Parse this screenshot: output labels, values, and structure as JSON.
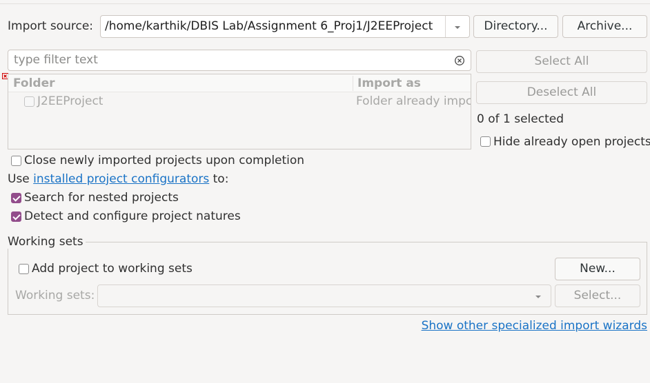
{
  "import_source": {
    "label": "Import source:",
    "value": "/home/karthik/DBIS Lab/Assignment 6_Proj1/J2EEProject",
    "directory_button": "Directory...",
    "archive_button": "Archive..."
  },
  "filter": {
    "placeholder": "type filter text"
  },
  "table": {
    "columns": [
      "Folder",
      "Import as"
    ],
    "rows": [
      {
        "folder": "J2EEProject",
        "import_as": "Folder already impc"
      }
    ]
  },
  "side": {
    "select_all": "Select All",
    "deselect_all": "Deselect All",
    "selected_count": "0 of 1 selected",
    "hide_open_label": "Hide already open projects"
  },
  "options": {
    "close_projects_label": "Close newly imported projects upon completion",
    "use_prefix": "Use",
    "configurators_link": "installed project configurators",
    "use_suffix": "to:",
    "search_nested_label": "Search for nested projects",
    "detect_natures_label": "Detect and configure project natures"
  },
  "working_sets": {
    "group_title": "Working sets",
    "add_label": "Add project to working sets",
    "new_button": "New...",
    "sets_label": "Working sets:",
    "select_button": "Select..."
  },
  "footer": {
    "wizards_link": "Show other specialized import wizards"
  },
  "colors": {
    "accent": "#924d8b",
    "link": "#1a73c6",
    "error": "#cc0000"
  }
}
